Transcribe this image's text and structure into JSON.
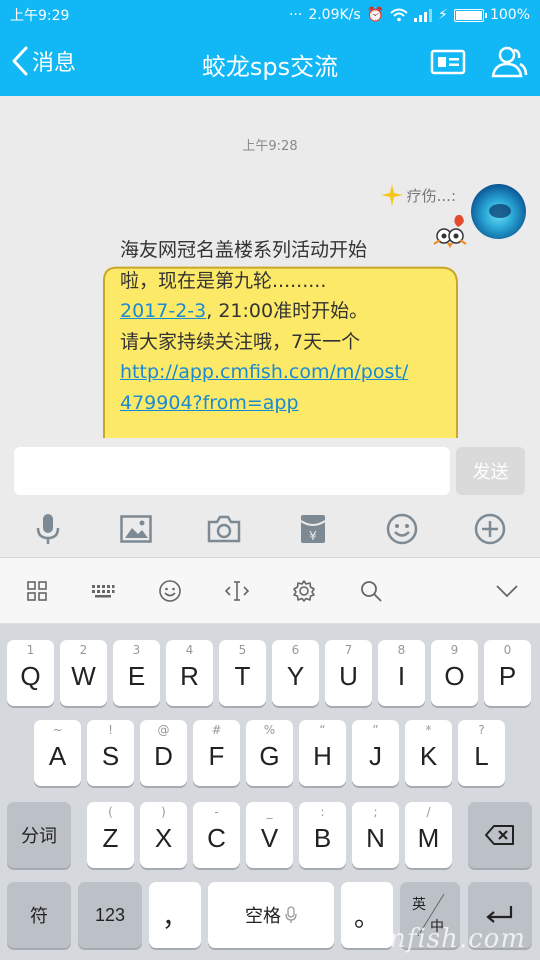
{
  "status": {
    "time": "上午9:29",
    "speed": "2.09K/s",
    "battery": "100%",
    "battery_fill": 1.0
  },
  "header": {
    "back_label": "消息",
    "title": "蛟龙sps交流"
  },
  "chat": {
    "timestamp": "上午9:28",
    "sender_name": "疗伤...:",
    "message": {
      "line1": "海友网冠名盖楼系列活动开始",
      "line2": "啦，现在是第九轮.........",
      "date_link": "2017-2-3",
      "line3_rest": ", 21:00准时开始。",
      "line4": "请大家持续关注哦，7天一个",
      "url_line1": "http://app.cmfish.com/m/post/",
      "url_line2": "479904?from=app"
    }
  },
  "input": {
    "value": "",
    "send_label": "发送"
  },
  "toolbar": [
    "mic-icon",
    "image-icon",
    "camera-icon",
    "red-packet-icon",
    "emoji-icon",
    "plus-icon"
  ],
  "keyboard": {
    "row1": [
      {
        "k": "Q",
        "s": "1"
      },
      {
        "k": "W",
        "s": "2"
      },
      {
        "k": "E",
        "s": "3"
      },
      {
        "k": "R",
        "s": "4"
      },
      {
        "k": "T",
        "s": "5"
      },
      {
        "k": "Y",
        "s": "6"
      },
      {
        "k": "U",
        "s": "7"
      },
      {
        "k": "I",
        "s": "8"
      },
      {
        "k": "O",
        "s": "9"
      },
      {
        "k": "P",
        "s": "0"
      }
    ],
    "row2": [
      {
        "k": "A",
        "s": "~"
      },
      {
        "k": "S",
        "s": "!"
      },
      {
        "k": "D",
        "s": "@"
      },
      {
        "k": "F",
        "s": "#"
      },
      {
        "k": "G",
        "s": "%"
      },
      {
        "k": "H",
        "s": "“"
      },
      {
        "k": "J",
        "s": "”"
      },
      {
        "k": "K",
        "s": "*"
      },
      {
        "k": "L",
        "s": "?"
      }
    ],
    "row3": [
      {
        "k": "Z",
        "s": "("
      },
      {
        "k": "X",
        "s": ")"
      },
      {
        "k": "C",
        "s": "-"
      },
      {
        "k": "V",
        "s": "_"
      },
      {
        "k": "B",
        "s": ":"
      },
      {
        "k": "N",
        "s": ";"
      },
      {
        "k": "M",
        "s": "/"
      }
    ],
    "fenci": "分词",
    "fu": "符",
    "num": "123",
    "comma": "，",
    "space": "空格",
    "period": "。",
    "lang_top": "英",
    "lang_bottom": "中"
  },
  "watermark": "cmfish.com"
}
